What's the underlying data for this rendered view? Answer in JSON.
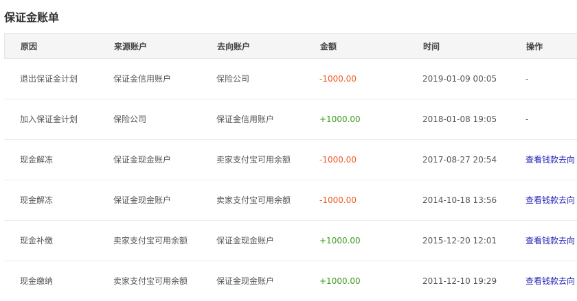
{
  "page": {
    "title": "保证金账单"
  },
  "table": {
    "headers": [
      "原因",
      "来源账户",
      "去向账户",
      "金额",
      "时间",
      "操作"
    ],
    "rows": [
      {
        "reason": "退出保证金计划",
        "source": "保证金信用账户",
        "destination": "保险公司",
        "amount": "-1000.00",
        "amount_sign": "negative",
        "time": "2019-01-09 00:05",
        "action": "-",
        "action_is_link": false
      },
      {
        "reason": "加入保证金计划",
        "source": "保险公司",
        "destination": "保证金信用账户",
        "amount": "+1000.00",
        "amount_sign": "positive",
        "time": "2018-01-08 19:05",
        "action": "-",
        "action_is_link": false
      },
      {
        "reason": "现金解冻",
        "source": "保证金现金账户",
        "destination": "卖家支付宝可用余额",
        "amount": "-1000.00",
        "amount_sign": "negative",
        "time": "2017-08-27 20:54",
        "action": "查看钱款去向",
        "action_is_link": true
      },
      {
        "reason": "现金解冻",
        "source": "保证金现金账户",
        "destination": "卖家支付宝可用余额",
        "amount": "-1000.00",
        "amount_sign": "negative",
        "time": "2014-10-18 13:56",
        "action": "查看钱款去向",
        "action_is_link": true
      },
      {
        "reason": "现金补缴",
        "source": "卖家支付宝可用余额",
        "destination": "保证金现金账户",
        "amount": "+1000.00",
        "amount_sign": "positive",
        "time": "2015-12-20 12:01",
        "action": "查看钱款去向",
        "action_is_link": true
      },
      {
        "reason": "现金缴纳",
        "source": "卖家支付宝可用余额",
        "destination": "保证金现金账户",
        "amount": "+1000.00",
        "amount_sign": "positive",
        "time": "2011-12-10 19:29",
        "action": "查看钱款去向",
        "action_is_link": true
      }
    ]
  },
  "colors": {
    "negative_amount": "#ee5a24",
    "positive_amount": "#3a9a1b",
    "link": "#1f1fb3",
    "header_background": "#f5f5f5"
  }
}
